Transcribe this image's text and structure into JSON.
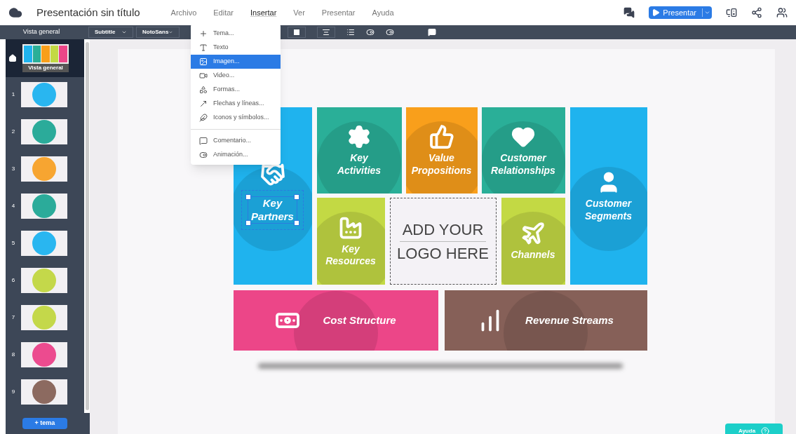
{
  "app": {
    "title": "Presentación sin título"
  },
  "menu": [
    {
      "label": "Archivo",
      "expanded": false
    },
    {
      "label": "Editar",
      "expanded": false
    },
    {
      "label": "Insertar",
      "expanded": true
    },
    {
      "label": "Ver",
      "expanded": false
    },
    {
      "label": "Presentar",
      "expanded": false
    },
    {
      "label": "Ayuda",
      "expanded": false
    }
  ],
  "present_button": {
    "label": "Presentar"
  },
  "sidebar": {
    "header": "Vista general",
    "overview": {
      "label": "Vista general",
      "selected": true
    },
    "add_button": "+ tema",
    "slides": [
      {
        "number": "1",
        "color": "#29b6f0",
        "selected": false
      },
      {
        "number": "2",
        "color": "#2bab9a",
        "selected": false
      },
      {
        "number": "3",
        "color": "#f7a531",
        "selected": false
      },
      {
        "number": "4",
        "color": "#2bab9a",
        "selected": false
      },
      {
        "number": "5",
        "color": "#29b6f0",
        "selected": false
      },
      {
        "number": "6",
        "color": "#c4d84a",
        "selected": false
      },
      {
        "number": "7",
        "color": "#c4d84a",
        "selected": false
      },
      {
        "number": "8",
        "color": "#ec4b8f",
        "selected": false
      },
      {
        "number": "9",
        "color": "#8c6a60",
        "selected": false
      }
    ]
  },
  "toolbar": {
    "style": "Subtitle",
    "font": "NotoSans"
  },
  "insert_menu": [
    {
      "label": "Tema...",
      "selected": false
    },
    {
      "label": "Texto",
      "selected": false
    },
    {
      "label": "Imagen...",
      "selected": true
    },
    {
      "label": "Video...",
      "selected": false
    },
    {
      "label": "Formas...",
      "selected": false
    },
    {
      "label": "Flechas y líneas...",
      "selected": false
    },
    {
      "label": "Iconos y símbolos...",
      "selected": false
    },
    {
      "label": "Comentario...",
      "selected": false
    },
    {
      "label": "Animación...",
      "selected": false
    }
  ],
  "canvas": {
    "tiles": [
      {
        "label": "Key Partners",
        "color": "#1fb3ee",
        "selected": true
      },
      {
        "label": "Key Activities",
        "color": "#2aaf98",
        "selected": false
      },
      {
        "label": "Value Propositions",
        "color": "#f99f1b",
        "selected": false
      },
      {
        "label": "Customer Relationships",
        "color": "#2aaf98",
        "selected": false
      },
      {
        "label": "Customer Segments",
        "color": "#1fb3ee",
        "selected": false
      },
      {
        "label": "Key Resources",
        "color": "#c3d944",
        "selected": false
      },
      {
        "label": "Channels",
        "color": "#c3d944",
        "selected": false
      },
      {
        "label": "Cost Structure",
        "color": "#ec4688",
        "selected": false
      },
      {
        "label": "Revenue Streams",
        "color": "#866058",
        "selected": false
      }
    ],
    "logo": [
      "ADD YOUR",
      "LOGO HERE"
    ]
  },
  "help_button": {
    "label": "Ayuda"
  }
}
